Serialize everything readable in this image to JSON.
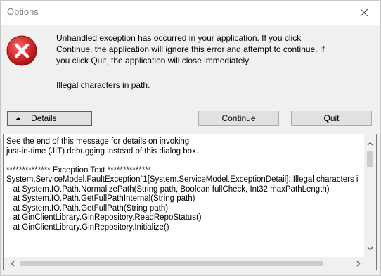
{
  "window": {
    "title": "Options"
  },
  "message": {
    "lines": [
      "Unhandled exception has occurred in your application. If you click",
      "Continue, the application will ignore this error and attempt to continue. If",
      "you click Quit, the application will close immediately."
    ],
    "detail": "Illegal characters in path."
  },
  "buttons": {
    "details_label": "Details",
    "continue_label": "Continue",
    "quit_label": "Quit"
  },
  "details": {
    "text": "See the end of this message for details on invoking\njust-in-time (JIT) debugging instead of this dialog box.\n\n************** Exception Text **************\nSystem.ServiceModel.FaultException`1[System.ServiceModel.ExceptionDetail]: Illegal characters in path.\n   at System.IO.Path.NormalizePath(String path, Boolean fullCheck, Int32 maxPathLength)\n   at System.IO.Path.GetFullPathInternal(String path)\n   at System.IO.Path.GetFullPath(String path)\n   at GinClientLibrary.GinRepository.ReadRepoStatus()\n   at GinClientLibrary.GinRepository.Initialize()"
  },
  "icons": {
    "error": "error-icon",
    "close": "close-icon"
  },
  "colors": {
    "accent": "#0078d7",
    "error_red": "#d42b2b"
  }
}
